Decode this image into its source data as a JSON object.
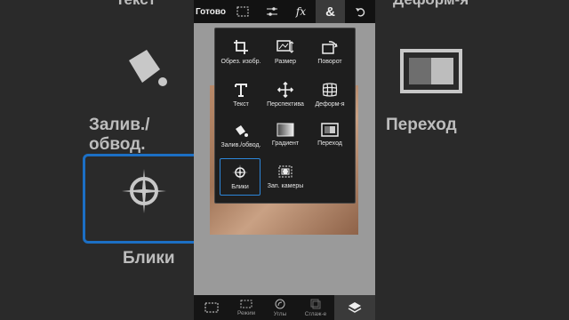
{
  "background": {
    "left_fill_label": "Залив./обвод.",
    "left_blik_label": "Блики",
    "right_transition_label": "Переход",
    "top_left_partial": "Текст",
    "top_right_partial": "Деформ-я"
  },
  "topbar": {
    "done_label": "Готово",
    "fx_label": "fx",
    "amp_label": "&"
  },
  "menu": {
    "items": [
      {
        "label": "Обрез. изобр.",
        "icon": "crop-icon"
      },
      {
        "label": "Размер",
        "icon": "resize-icon"
      },
      {
        "label": "Поворот",
        "icon": "rotate-icon"
      },
      {
        "label": "Текст",
        "icon": "text-icon"
      },
      {
        "label": "Перспектива",
        "icon": "perspective-icon"
      },
      {
        "label": "Деформ-я",
        "icon": "warp-icon"
      },
      {
        "label": "Залив./обвод.",
        "icon": "fill-bucket-icon"
      },
      {
        "label": "Градиент",
        "icon": "gradient-icon"
      },
      {
        "label": "Переход",
        "icon": "transition-icon"
      },
      {
        "label": "Блики",
        "icon": "flare-icon",
        "selected": true
      },
      {
        "label": "Зап. камеры",
        "icon": "camera-shake-icon"
      }
    ]
  },
  "bottombar": {
    "mode_label": "Режим",
    "corners_label": "Углы",
    "smooth_label": "Сглаж-е"
  },
  "colors": {
    "accent": "#2d86d9"
  }
}
